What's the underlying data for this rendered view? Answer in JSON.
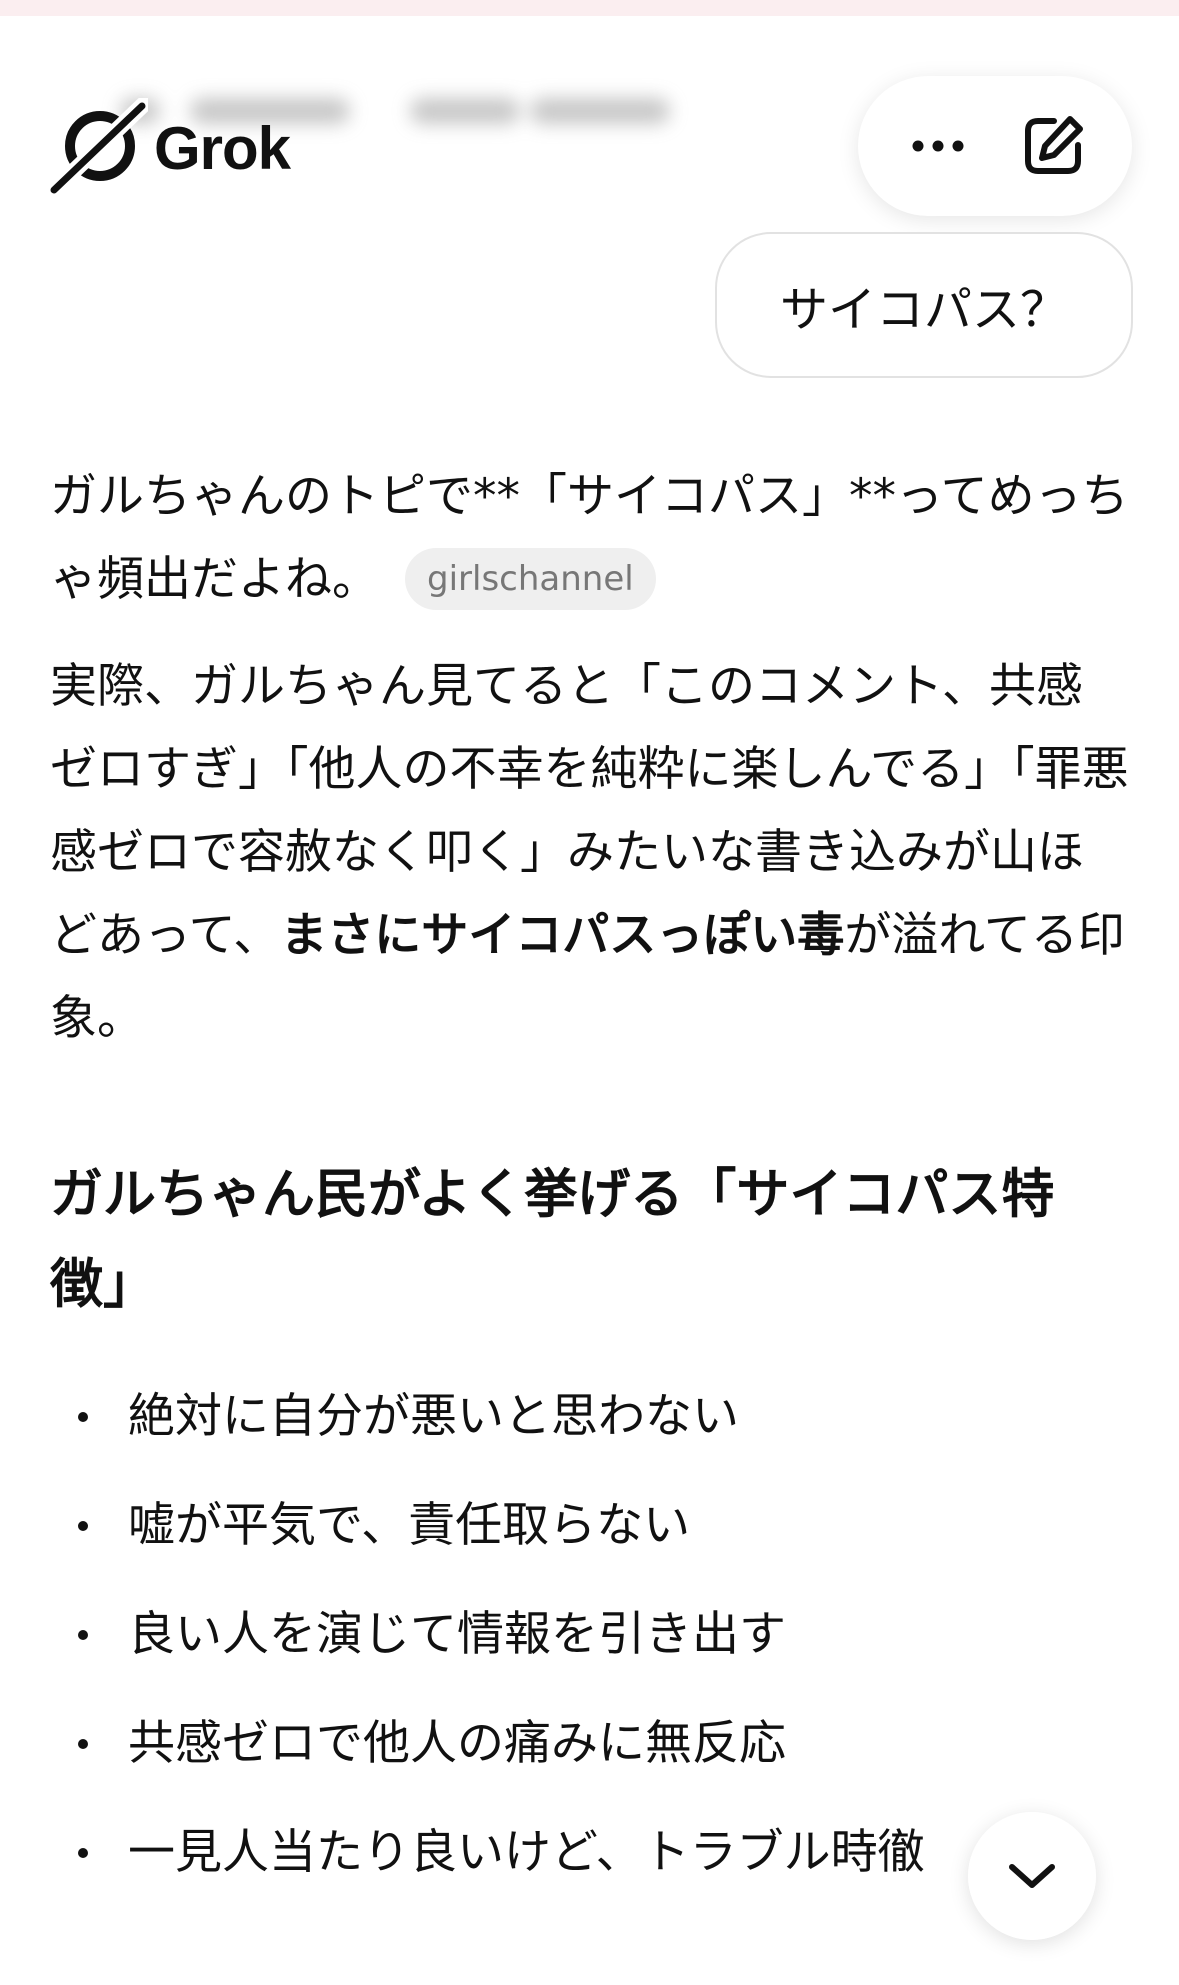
{
  "app": {
    "name": "Grok"
  },
  "header": {
    "logo_text": "Grok",
    "more_icon": "more-horizontal-icon",
    "edit_icon": "new-chat-edit-icon"
  },
  "conversation": {
    "user_message": "サイコパス？",
    "response": {
      "p1_text": "ガルちゃんのトピで**「サイコパス」**ってめっちゃ頻出だよね。",
      "p1_source_chip": "girlschannel",
      "p2_text": "実際、ガルちゃん見てると「このコメント、共感ゼロすぎ」「他人の不幸を純粋に楽しんでる」「罪悪感ゼロで容赦なく叩く」みたいな書き込みが山ほどあって、",
      "p2_bold": "まさにサイコパスっぽい毒",
      "p2_tail": "が溢れてる印象。",
      "heading": "ガルちゃん民がよく挙げる「サイコパス特徴」",
      "bullets": [
        "絶対に自分が悪いと思わない",
        "嘘が平気で、責任取らない",
        "良い人を演じて情報を引き出す",
        "共感ゼロで他人の痛みに無反応",
        "一見人当たり良いけど、トラブル時徹"
      ]
    }
  },
  "scroll_button": {
    "icon": "chevron-down-icon"
  },
  "colors": {
    "text": "#111111",
    "chip_bg": "#efefef",
    "chip_text": "#777777",
    "bubble_border": "#e2e2e2"
  }
}
